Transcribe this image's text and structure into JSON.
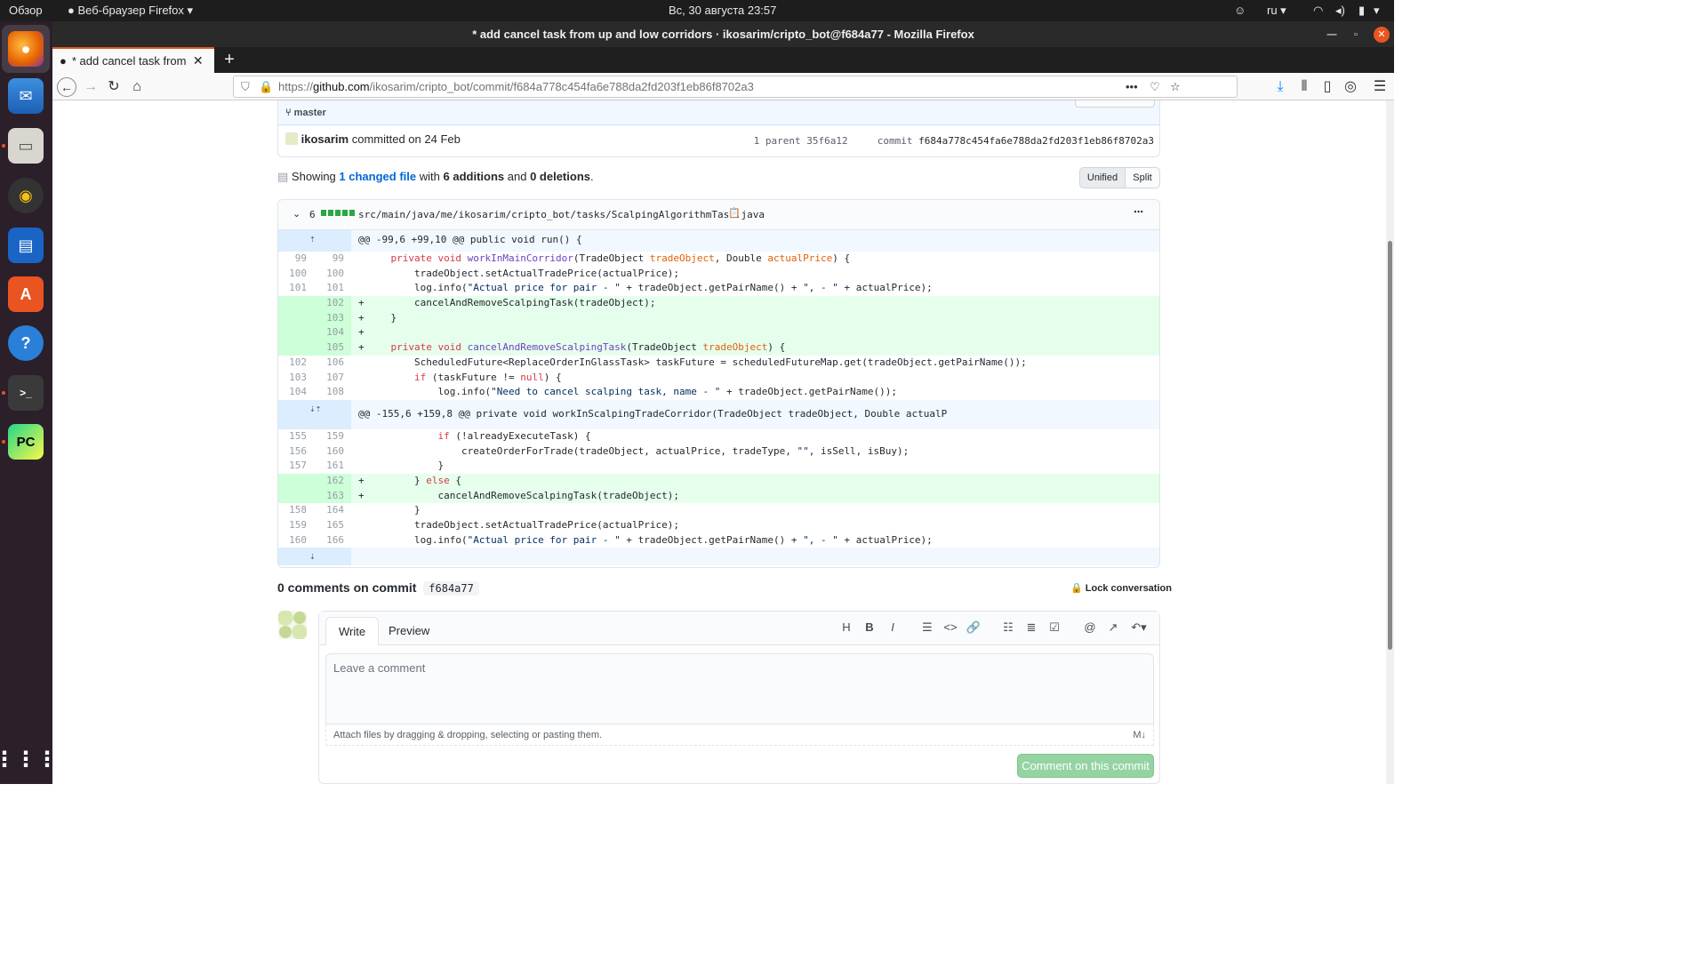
{
  "topbar": {
    "overview": "Обзор",
    "app_menu": "Веб-браузер Firefox",
    "clock": "Вс, 30 августа  23:57",
    "lang": "ru"
  },
  "window": {
    "title": "* add cancel task from up and low corridors · ikosarim/cripto_bot@f684a77 - Mozilla Firefox"
  },
  "tab": {
    "title": "* add cancel task from up and low corridors"
  },
  "navbar": {
    "url_scheme": "https://",
    "url_host": "github.com",
    "url_path": "/ikosarim/cripto_bot/commit/f684a778c454fa6e788da2fd203f1eb86f8702a3"
  },
  "commit": {
    "branch": "master",
    "author": "ikosarim",
    "committed_text": "committed on 24 Feb",
    "parent_label": "1 parent",
    "parent_sha": "35f6a12",
    "commit_label": "commit",
    "commit_sha": "f684a778c454fa6e788da2fd203f1eb86f8702a3"
  },
  "summary": {
    "showing": "Showing",
    "changed": "1 changed file",
    "with": "with",
    "additions": "6 additions",
    "and": "and",
    "deletions": "0 deletions",
    "period": "."
  },
  "view_toggle": {
    "unified": "Unified",
    "split": "Split"
  },
  "diff": {
    "count": "6",
    "path": "src/main/java/me/ikosarim/cripto_bot/tasks/ScalpingAlgorithmTask.java",
    "lines": [
      {
        "type": "hunk",
        "old": "",
        "new": "",
        "sign": "",
        "code": "@@ -99,6 +99,10 @@ public void run() {"
      },
      {
        "type": "ctx",
        "old": "99",
        "new": "99",
        "sign": "",
        "code": "    private void workInMainCorridor(TradeObject tradeObject, Double actualPrice) {"
      },
      {
        "type": "ctx",
        "old": "100",
        "new": "100",
        "sign": "",
        "code": "        tradeObject.setActualTradePrice(actualPrice);"
      },
      {
        "type": "ctx",
        "old": "101",
        "new": "101",
        "sign": "",
        "code": "        log.info(\"Actual price for pair - \" + tradeObject.getPairName() + \", - \" + actualPrice);"
      },
      {
        "type": "add",
        "old": "",
        "new": "102",
        "sign": "+",
        "code": "        cancelAndRemoveScalpingTask(tradeObject);"
      },
      {
        "type": "add",
        "old": "",
        "new": "103",
        "sign": "+",
        "code": "    }"
      },
      {
        "type": "add",
        "old": "",
        "new": "104",
        "sign": "+",
        "code": ""
      },
      {
        "type": "add",
        "old": "",
        "new": "105",
        "sign": "+",
        "code": "    private void cancelAndRemoveScalpingTask(TradeObject tradeObject) {"
      },
      {
        "type": "ctx",
        "old": "102",
        "new": "106",
        "sign": "",
        "code": "        ScheduledFuture<ReplaceOrderInGlassTask> taskFuture = scheduledFutureMap.get(tradeObject.getPairName());"
      },
      {
        "type": "ctx",
        "old": "103",
        "new": "107",
        "sign": "",
        "code": "        if (taskFuture != null) {"
      },
      {
        "type": "ctx",
        "old": "104",
        "new": "108",
        "sign": "",
        "code": "            log.info(\"Need to cancel scalping task, name - \" + tradeObject.getPairName());"
      },
      {
        "type": "hunk",
        "old": "",
        "new": "",
        "sign": "",
        "code": "@@ -155,6 +159,8 @@ private void workInScalpingTradeCorridor(TradeObject tradeObject, Double actualP"
      },
      {
        "type": "ctx",
        "old": "155",
        "new": "159",
        "sign": "",
        "code": "            if (!alreadyExecuteTask) {"
      },
      {
        "type": "ctx",
        "old": "156",
        "new": "160",
        "sign": "",
        "code": "                createOrderForTrade(tradeObject, actualPrice, tradeType, \"\", isSell, isBuy);"
      },
      {
        "type": "ctx",
        "old": "157",
        "new": "161",
        "sign": "",
        "code": "            }"
      },
      {
        "type": "add",
        "old": "",
        "new": "162",
        "sign": "+",
        "code": "        } else {"
      },
      {
        "type": "add",
        "old": "",
        "new": "163",
        "sign": "+",
        "code": "            cancelAndRemoveScalpingTask(tradeObject);"
      },
      {
        "type": "ctx",
        "old": "158",
        "new": "164",
        "sign": "",
        "code": "        }"
      },
      {
        "type": "ctx",
        "old": "159",
        "new": "165",
        "sign": "",
        "code": "        tradeObject.setActualTradePrice(actualPrice);"
      },
      {
        "type": "ctx",
        "old": "160",
        "new": "166",
        "sign": "",
        "code": "        log.info(\"Actual price for pair - \" + tradeObject.getPairName() + \", - \" + actualPrice);"
      },
      {
        "type": "hunk",
        "old": "",
        "new": "",
        "sign": "",
        "code": ""
      }
    ]
  },
  "comments": {
    "title": "0 comments on commit",
    "sha": "f684a77",
    "lock": "Lock conversation",
    "write_tab": "Write",
    "preview_tab": "Preview",
    "placeholder": "Leave a comment",
    "attach": "Attach files by dragging & dropping, selecting or pasting them.",
    "submit": "Comment on this commit"
  }
}
